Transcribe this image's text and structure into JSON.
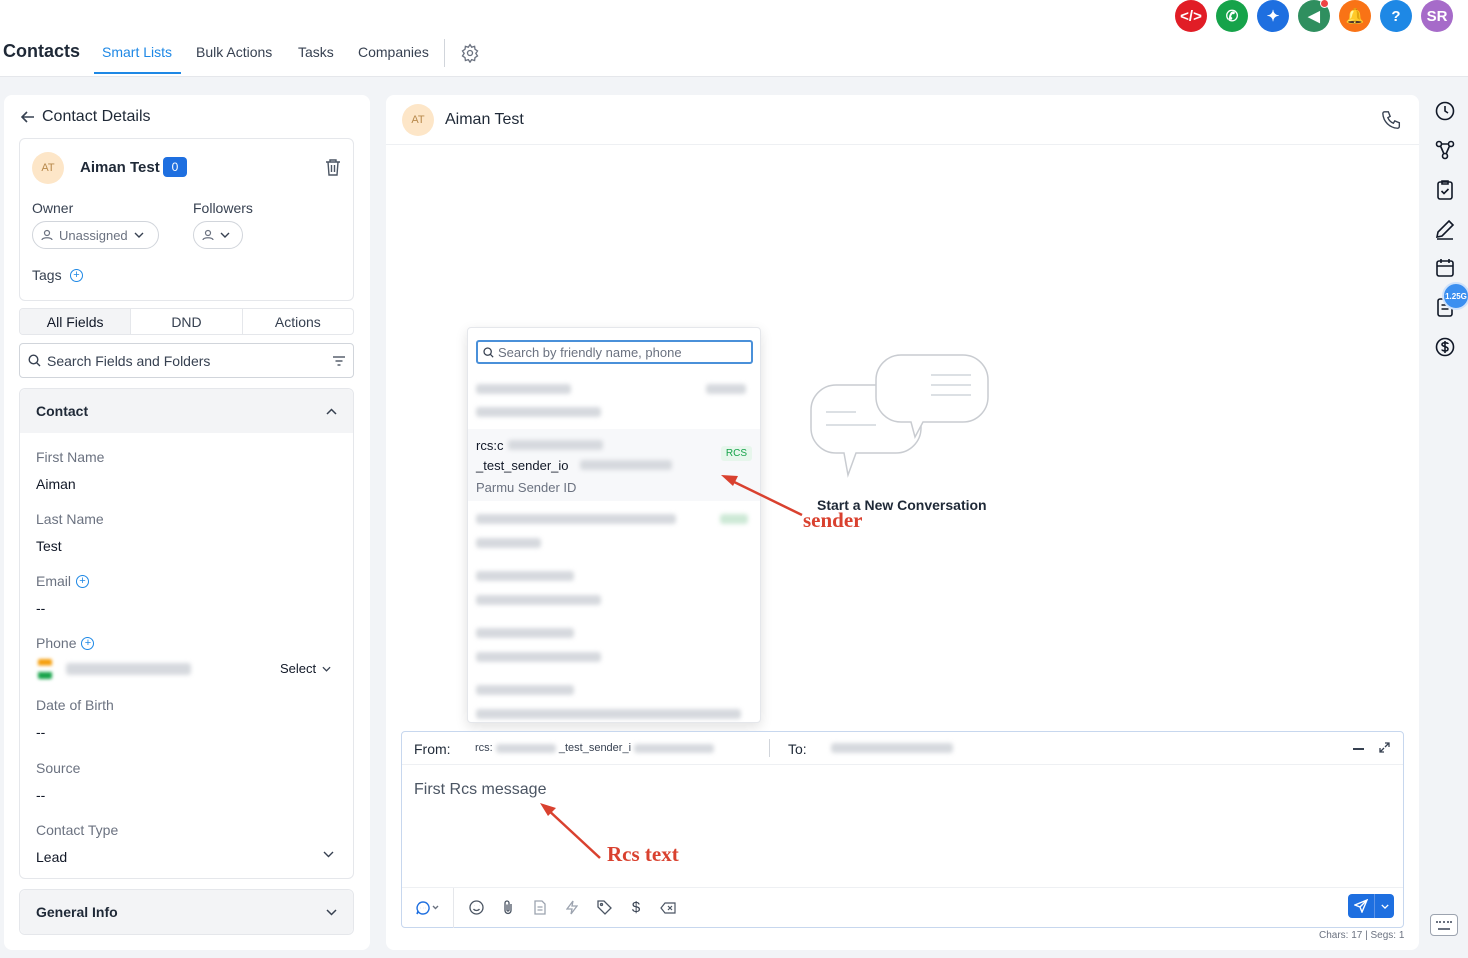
{
  "top_icons": [
    {
      "name": "code-icon",
      "glyph": "</>",
      "color": "#e11d26"
    },
    {
      "name": "phone-icon",
      "glyph": "✆",
      "color": "#16a34a"
    },
    {
      "name": "magic-icon",
      "glyph": "✦",
      "color": "#1e6fe0"
    },
    {
      "name": "megaphone-icon",
      "glyph": "◀",
      "color": "#2f8f5f"
    },
    {
      "name": "bell-icon",
      "glyph": "🔔",
      "color": "#f97316"
    },
    {
      "name": "help-icon",
      "glyph": "?",
      "color": "#1e88e5"
    },
    {
      "name": "user-avatar",
      "glyph": "SR",
      "color": "#a66bc9"
    }
  ],
  "nav": {
    "title": "Contacts",
    "tabs": [
      "Smart Lists",
      "Bulk Actions",
      "Tasks",
      "Companies"
    ],
    "active_tab": "Smart Lists"
  },
  "left": {
    "back_label": "Contact Details",
    "contact_initials": "AT",
    "contact_name": "Aiman Test",
    "badge_count": "0",
    "owner_label": "Owner",
    "owner_value": "Unassigned",
    "followers_label": "Followers",
    "tags_label": "Tags",
    "tabs": [
      "All Fields",
      "DND",
      "Actions"
    ],
    "search_placeholder": "Search Fields and Folders",
    "section_contact": "Contact",
    "fields": {
      "first_name_label": "First Name",
      "first_name": "Aiman",
      "last_name_label": "Last Name",
      "last_name": "Test",
      "email_label": "Email",
      "email": "--",
      "phone_label": "Phone",
      "phone_select": "Select",
      "dob_label": "Date of Birth",
      "dob": "--",
      "source_label": "Source",
      "source": "--",
      "contact_type_label": "Contact Type",
      "contact_type": "Lead"
    },
    "section_general": "General Info"
  },
  "conversation": {
    "initials": "AT",
    "name": "Aiman Test",
    "empty_title": "Start a New Conversation",
    "dropdown": {
      "search_placeholder": "Search by friendly name, phone",
      "selected_prefix_line1": "rcs:c",
      "selected_line2_prefix": "_test_sender_io",
      "selected_sub": "Parmu Sender ID",
      "tag": "RCS"
    },
    "from_label": "From:",
    "from_value": "rcs:",
    "from_value_mid": "_test_sender_i",
    "to_label": "To:",
    "message": "First Rcs message",
    "counter": "Chars: 17 | Segs: 1"
  },
  "annotations": {
    "sender": "sender",
    "rcs_text": "Rcs text"
  },
  "rail": {
    "badge": "1.25G"
  }
}
